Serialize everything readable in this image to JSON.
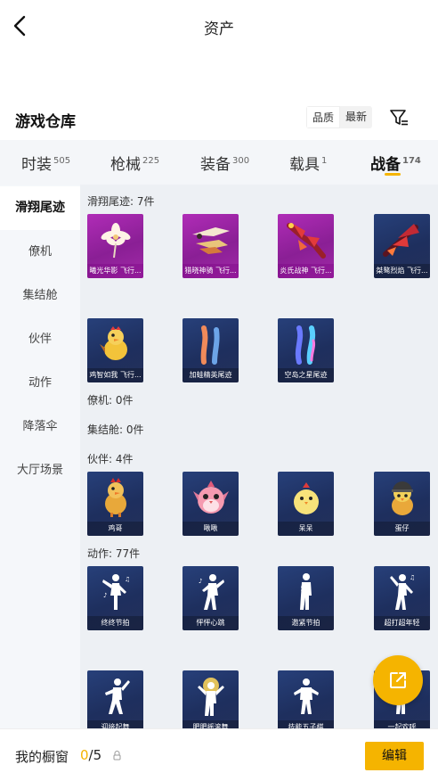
{
  "header": {
    "title": "资产"
  },
  "warehouse": {
    "title": "游戏仓库",
    "sort": [
      "品质",
      "最新"
    ],
    "filter_icon": "filter-icon"
  },
  "tabs": [
    {
      "label": "时装",
      "count": "505"
    },
    {
      "label": "枪械",
      "count": "225"
    },
    {
      "label": "装备",
      "count": "300"
    },
    {
      "label": "载具",
      "count": "1"
    },
    {
      "label": "战备",
      "count": "174",
      "active": true
    }
  ],
  "sidebar": [
    {
      "label": "滑翔尾迹",
      "active": true
    },
    {
      "label": "僚机"
    },
    {
      "label": "集结舱"
    },
    {
      "label": "伙伴"
    },
    {
      "label": "动作"
    },
    {
      "label": "降落伞"
    },
    {
      "label": "大厅场景"
    }
  ],
  "categories": {
    "trails": {
      "label": "滑翔尾迹: 7件",
      "items": [
        {
          "name": "曦光华影 飞行...",
          "rarity": "mythic",
          "icon": "flower-trail-icon"
        },
        {
          "name": "猎晓神骑 飞行...",
          "rarity": "mythic",
          "icon": "golden-wing-icon"
        },
        {
          "name": "炎氏战神 飞行...",
          "rarity": "mythic",
          "icon": "red-dragon-icon"
        },
        {
          "name": "桀骜烈焰 飞行...",
          "rarity": "legend",
          "icon": "crimson-wing-icon"
        },
        {
          "name": "鸡智如我 飞行...",
          "rarity": "legend",
          "icon": "chicken-icon"
        },
        {
          "name": "加蛙精英尾迹",
          "rarity": "legend",
          "icon": "smoke-trail-icon"
        },
        {
          "name": "空岛之星尾迹",
          "rarity": "legend",
          "icon": "rainbow-trail-icon"
        }
      ]
    },
    "wingman": {
      "label": "僚机: 0件"
    },
    "pod": {
      "label": "集结舱: 0件"
    },
    "partners": {
      "label": "伙伴: 4件",
      "items": [
        {
          "name": "鸡哥",
          "icon": "rooster-partner-icon"
        },
        {
          "name": "啾啾",
          "icon": "pink-bird-icon"
        },
        {
          "name": "呆呆",
          "icon": "chick-partner-icon"
        },
        {
          "name": "蛋仔",
          "icon": "helmet-duck-icon"
        }
      ]
    },
    "emotes": {
      "label": "动作: 77件",
      "items": [
        {
          "name": "终终节拍",
          "icon": "dance-icon"
        },
        {
          "name": "怦怦心跳",
          "icon": "dance-icon"
        },
        {
          "name": "邀紧节拍",
          "icon": "dance-icon"
        },
        {
          "name": "超打超年轻",
          "icon": "dance-icon"
        },
        {
          "name": "迎接起舞",
          "icon": "dance-icon"
        },
        {
          "name": "肥肥摇滚舞",
          "icon": "dance-icon"
        },
        {
          "name": "技能五子棋",
          "icon": "dance-icon"
        },
        {
          "name": "一起欢呼",
          "icon": "dance-icon"
        }
      ]
    }
  },
  "fab": {
    "icon": "share-icon"
  },
  "bottom": {
    "window_label": "我的橱窗",
    "current": "0",
    "max": "/5",
    "edit_label": "编辑"
  },
  "colors": {
    "accent": "#f5b400",
    "mythic": "#a62aae",
    "legend": "#23376b"
  }
}
